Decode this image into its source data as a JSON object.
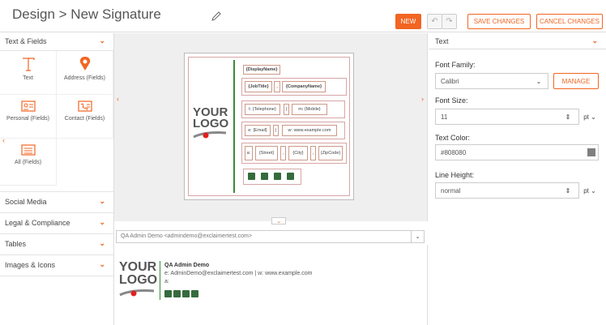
{
  "header": {
    "title": "Design > New Signature",
    "new_label": "NEW",
    "save_label": "SAVE CHANGES",
    "cancel_label": "CANCEL CHANGES"
  },
  "left": {
    "sections": [
      {
        "label": "Text & Fields"
      },
      {
        "label": "Social Media"
      },
      {
        "label": "Legal & Compliance"
      },
      {
        "label": "Tables"
      },
      {
        "label": "Images & Icons"
      }
    ],
    "tools": [
      {
        "label": "Text",
        "icon": "text-icon"
      },
      {
        "label": "Address (Fields)",
        "icon": "map-pin-icon"
      },
      {
        "label": "Personal (Fields)",
        "icon": "person-card-icon"
      },
      {
        "label": "Contact (Fields)",
        "icon": "phone-icon"
      },
      {
        "label": "All (Fields)",
        "icon": "list-icon"
      }
    ]
  },
  "signature": {
    "logo_line1": "YOUR",
    "logo_line2": "LOGO",
    "display_name": "{DisplayName}",
    "job_title": "{JobTitle}",
    "comma": ",",
    "company": "{CompanyName}",
    "telephone": "t: {Telephone}",
    "pipe": "|",
    "mobile": "m: {Mobile}",
    "email": "e: {Email}",
    "website": "w: www.example.com",
    "addr_prefix": "a:",
    "street": "{Street}",
    "city": "{City}",
    "zipcode": "{ZipCode}"
  },
  "preview": {
    "sender": "QA Admin Demo <admindemo@exclaimertest.com>",
    "name": "QA Admin Demo",
    "line2": "e: AdminDemo@exclaimertest.com  |  w: www.example.com",
    "line3": "a:"
  },
  "right": {
    "header": "Text",
    "font_family_label": "Font Family:",
    "font_family_value": "Calibri",
    "manage_label": "MANAGE",
    "font_size_label": "Font Size:",
    "font_size_value": "11",
    "size_unit": "pt",
    "text_color_label": "Text Color:",
    "text_color_value": "#808080",
    "line_height_label": "Line Height:",
    "line_height_value": "normal",
    "line_height_unit": "pt"
  },
  "colors": {
    "accent": "#f26522",
    "green": "#3a8a3a",
    "social": "#356b3c"
  }
}
